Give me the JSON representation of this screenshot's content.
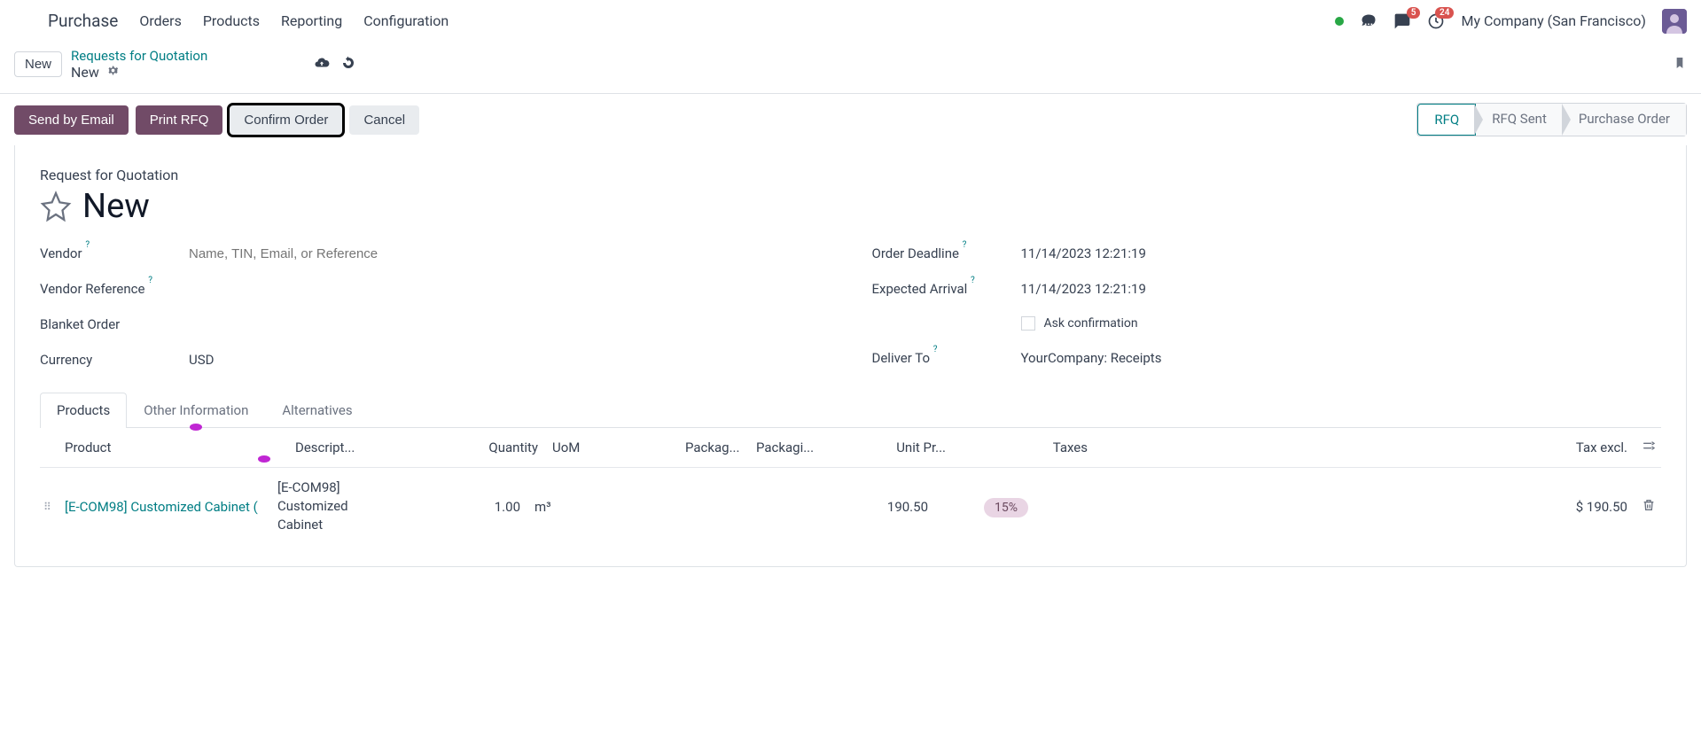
{
  "topnav": {
    "app_name": "Purchase",
    "menu": [
      "Orders",
      "Products",
      "Reporting",
      "Configuration"
    ],
    "badges": {
      "messages": "5",
      "activities": "24"
    },
    "company": "My Company (San Francisco)"
  },
  "crumb": {
    "new_btn": "New",
    "link": "Requests for Quotation",
    "current": "New"
  },
  "actions": {
    "send": "Send by Email",
    "print": "Print RFQ",
    "confirm": "Confirm Order",
    "cancel": "Cancel",
    "status_steps": [
      "RFQ",
      "RFQ Sent",
      "Purchase Order"
    ]
  },
  "sheet": {
    "subtitle": "Request for Quotation",
    "title": "New",
    "left": {
      "vendor_label": "Vendor",
      "vendor_placeholder": "Name, TIN, Email, or Reference",
      "vendor_ref_label": "Vendor Reference",
      "blanket_label": "Blanket Order",
      "currency_label": "Currency",
      "currency_value": "USD"
    },
    "right": {
      "deadline_label": "Order Deadline",
      "deadline_value": "11/14/2023 12:21:19",
      "arrival_label": "Expected Arrival",
      "arrival_value": "11/14/2023 12:21:19",
      "ask_conf_label": "Ask confirmation",
      "deliver_label": "Deliver To",
      "deliver_value": "YourCompany: Receipts"
    }
  },
  "tabs": [
    "Products",
    "Other Information",
    "Alternatives"
  ],
  "table": {
    "headers": {
      "product": "Product",
      "desc": "Descript...",
      "qty": "Quantity",
      "uom": "UoM",
      "pkg": "Packag...",
      "pkg2": "Packagi...",
      "unit": "Unit Pr...",
      "tax": "Taxes",
      "total": "Tax excl."
    },
    "rows": [
      {
        "product": "[E-COM98] Customized Cabinet (",
        "desc": "[E-COM98] Customized Cabinet",
        "qty": "1.00",
        "uom": "m³",
        "unit": "190.50",
        "tax": "15%",
        "total": "$ 190.50"
      }
    ]
  }
}
